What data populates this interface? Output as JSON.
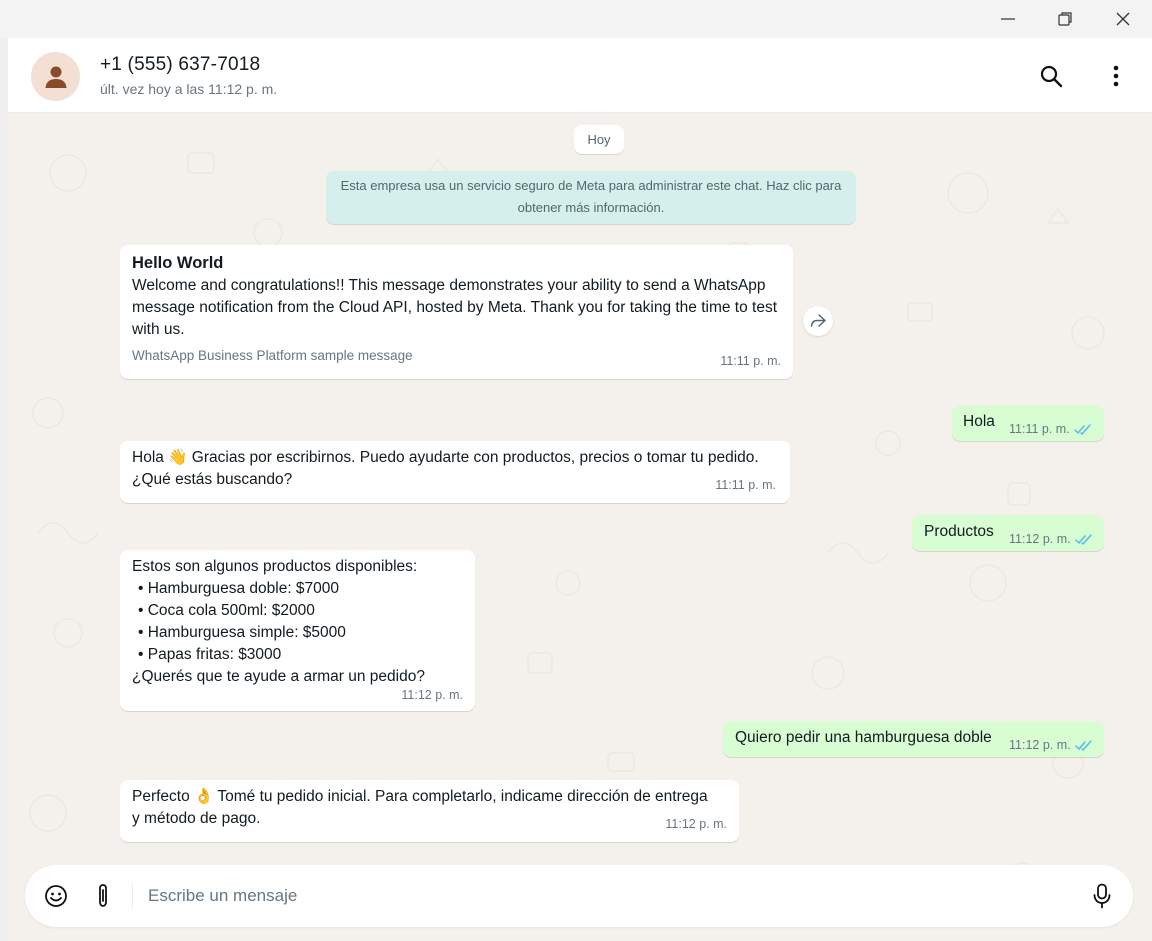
{
  "window": {
    "minimize_icon": "minimize-icon",
    "maximize_icon": "restore-icon",
    "close_icon": "close-icon"
  },
  "header": {
    "contact_name": "+1 (555) 637-7018",
    "last_seen": "últ. vez hoy a las 11:12 p. m.",
    "avatar_icon": "person-icon",
    "search_icon": "search-icon",
    "menu_icon": "more-vertical-icon"
  },
  "chat": {
    "day_label": "Hoy",
    "system_notice": "Esta empresa usa un servicio seguro de Meta para administrar este chat. Haz clic para obtener más información.",
    "messages": [
      {
        "direction": "in",
        "title": "Hello World",
        "body": "Welcome and congratulations!! This message demonstrates your ability to send a WhatsApp message notification from the Cloud API, hosted by Meta. Thank you for taking the time to test with us.",
        "footer": "WhatsApp Business Platform sample message",
        "time": "11:11 p. m."
      },
      {
        "direction": "out",
        "text": "Hola",
        "time": "11:11 p. m.",
        "status": "read"
      },
      {
        "direction": "in",
        "line1": "Hola 👋 Gracias por escribirnos. Puedo ayudarte con productos, precios o tomar tu pedido.",
        "line2": "¿Qué estás buscando?",
        "time": "11:11 p. m."
      },
      {
        "direction": "out",
        "text": "Productos",
        "time": "11:12 p. m.",
        "status": "read"
      },
      {
        "direction": "in",
        "intro": "Estos son algunos productos disponibles:",
        "items": [
          "• Hamburguesa doble: $7000",
          "• Coca cola 500ml: $2000",
          "• Hamburguesa simple: $5000",
          "• Papas fritas: $3000"
        ],
        "outro": "¿Querés que te ayude a armar un pedido?",
        "time": "11:12 p. m."
      },
      {
        "direction": "out",
        "text": "Quiero pedir una hamburguesa doble",
        "time": "11:12 p. m.",
        "status": "read"
      },
      {
        "direction": "in",
        "line1": "Perfecto 👌 Tomé tu pedido inicial. Para completarlo, indicame dirección de entrega",
        "line2": "y método de pago.",
        "time": "11:12 p. m."
      }
    ],
    "forward_icon": "forward-icon"
  },
  "composer": {
    "placeholder": "Escribe un mensaje",
    "value": "",
    "emoji_icon": "emoji-icon",
    "attach_icon": "paperclip-icon",
    "mic_icon": "microphone-icon"
  },
  "colors": {
    "incoming_bubble": "#ffffff",
    "outgoing_bubble": "#d9fdd3",
    "chat_background": "#f4f0eb",
    "system_notice": "#d5efec",
    "read_ticks": "#53bdeb"
  }
}
